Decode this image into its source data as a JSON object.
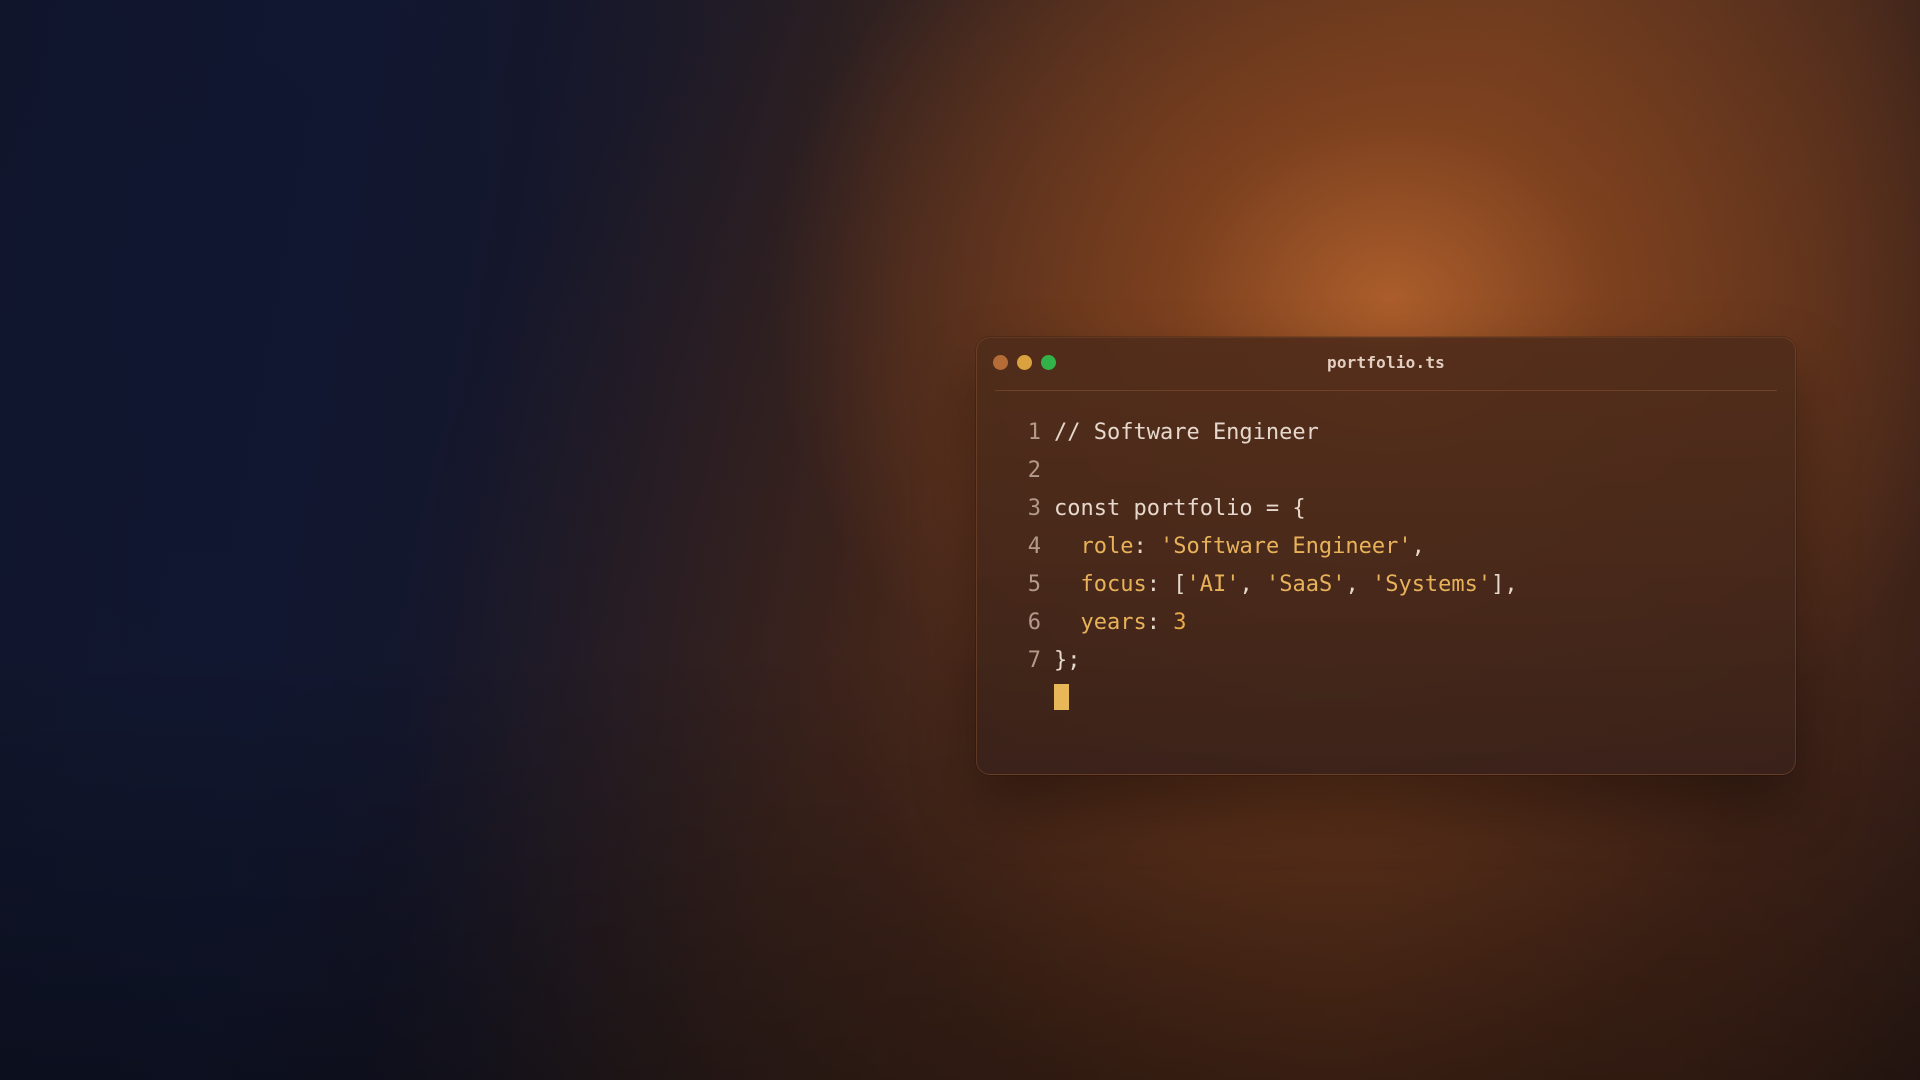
{
  "editor": {
    "filename": "portfolio.ts",
    "lines": [
      {
        "number": "1",
        "parts": [
          {
            "cls": "plain",
            "text": "// Software Engineer"
          }
        ]
      },
      {
        "number": "2",
        "parts": []
      },
      {
        "number": "3",
        "parts": [
          {
            "cls": "plain",
            "text": "const portfolio = {"
          }
        ]
      },
      {
        "number": "4",
        "parts": [
          {
            "cls": "plain",
            "text": "  "
          },
          {
            "cls": "key",
            "text": "role"
          },
          {
            "cls": "plain",
            "text": ": "
          },
          {
            "cls": "str",
            "text": "'Software Engineer'"
          },
          {
            "cls": "plain",
            "text": ","
          }
        ]
      },
      {
        "number": "5",
        "parts": [
          {
            "cls": "plain",
            "text": "  "
          },
          {
            "cls": "key",
            "text": "focus"
          },
          {
            "cls": "plain",
            "text": ": ["
          },
          {
            "cls": "str",
            "text": "'AI'"
          },
          {
            "cls": "plain",
            "text": ", "
          },
          {
            "cls": "str",
            "text": "'SaaS'"
          },
          {
            "cls": "plain",
            "text": ", "
          },
          {
            "cls": "str",
            "text": "'Systems'"
          },
          {
            "cls": "plain",
            "text": "],"
          }
        ]
      },
      {
        "number": "6",
        "parts": [
          {
            "cls": "plain",
            "text": "  "
          },
          {
            "cls": "key",
            "text": "years"
          },
          {
            "cls": "plain",
            "text": ": "
          },
          {
            "cls": "num",
            "text": "3"
          }
        ]
      },
      {
        "number": "7",
        "parts": [
          {
            "cls": "plain",
            "text": "};"
          }
        ]
      }
    ]
  },
  "colors": {
    "accent": "#e8b25a",
    "traffic_red": "#c0733a",
    "traffic_yellow": "#d9a23e",
    "traffic_green": "#33b24a"
  }
}
